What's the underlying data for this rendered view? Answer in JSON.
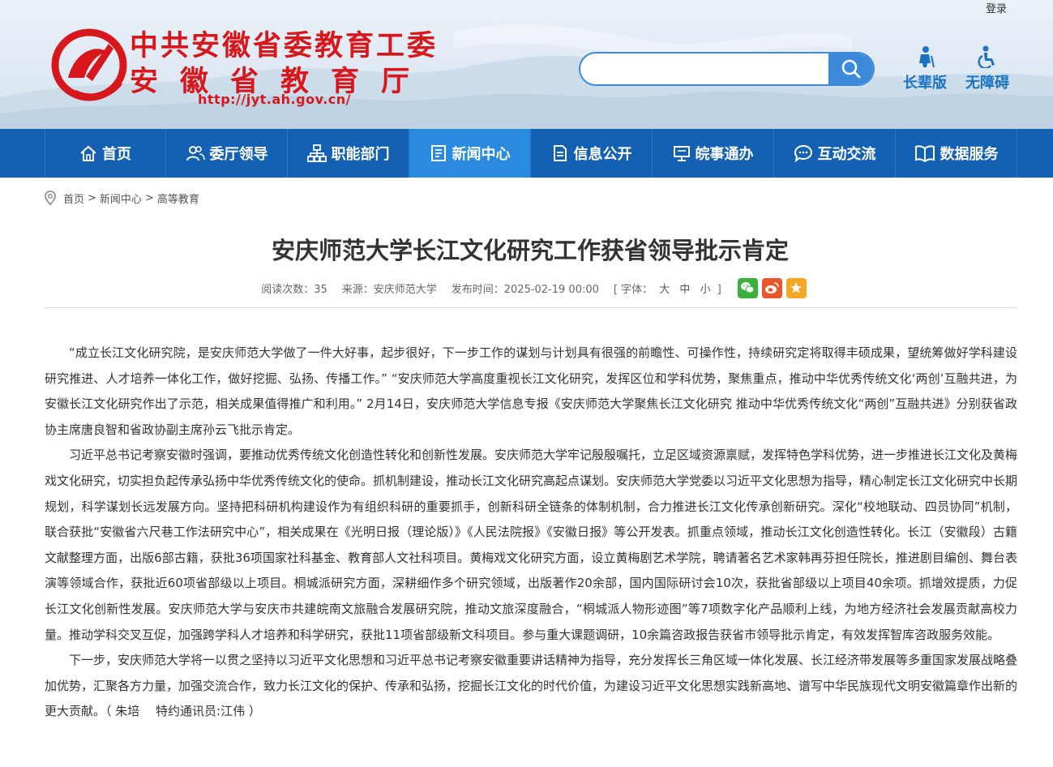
{
  "header": {
    "login": "登录",
    "logo_line1": "中共安徽省委教育工委",
    "logo_line2": "安徽省教育厅",
    "logo_url": "http://jyt.ah.gov.cn/",
    "search_placeholder": "",
    "tools": [
      {
        "label": "长辈版",
        "icon": "elder-icon"
      },
      {
        "label": "无障碍",
        "icon": "wheelchair-icon"
      }
    ]
  },
  "nav": [
    {
      "label": "首页",
      "icon": "home-icon"
    },
    {
      "label": "委厅领导",
      "icon": "people-icon"
    },
    {
      "label": "职能部门",
      "icon": "org-icon"
    },
    {
      "label": "新闻中心",
      "icon": "news-icon",
      "active": true
    },
    {
      "label": "信息公开",
      "icon": "document-icon"
    },
    {
      "label": "皖事通办",
      "icon": "monitor-icon"
    },
    {
      "label": "互动交流",
      "icon": "chat-icon"
    },
    {
      "label": "数据服务",
      "icon": "book-icon"
    }
  ],
  "breadcrumb": [
    "首页",
    "新闻中心",
    "高等教育"
  ],
  "article": {
    "title": "安庆师范大学长江文化研究工作获省领导批示肯定",
    "views": "阅读次数：35",
    "source": "来源：安庆师范大学",
    "time": "发布时间：2025-02-19 00:00",
    "font_label": "[ 字体：",
    "font_large": "大",
    "font_medium": "中",
    "font_small": "小",
    "font_end": "]",
    "share": [
      "wechat-icon",
      "weibo-icon",
      "favorite-icon"
    ],
    "paragraphs": [
      "“成立长江文化研究院，是安庆师范大学做了一件大好事，起步很好，下一步工作的谋划与计划具有很强的前瞻性、可操作性，持续研究定将取得丰硕成果，望统筹做好学科建设研究推进、人才培养一体化工作，做好挖掘、弘扬、传播工作。” “安庆师范大学高度重视长江文化研究，发挥区位和学科优势，聚焦重点，推动中华优秀传统文化‘两创’互融共进，为安徽长江文化研究作出了示范，相关成果值得推广和利用。” 2月14日，安庆师范大学信息专报《安庆师范大学聚焦长江文化研究 推动中华优秀传统文化“两创”互融共进》分别获省政协主席唐良智和省政协副主席孙云飞批示肯定。",
      "习近平总书记考察安徽时强调，要推动优秀传统文化创造性转化和创新性发展。安庆师范大学牢记殷殷嘱托，立足区域资源禀赋，发挥特色学科优势，进一步推进长江文化及黄梅戏文化研究，切实担负起传承弘扬中华优秀传统文化的使命。抓机制建设，推动长江文化研究高起点谋划。安庆师范大学党委以习近平文化思想为指导，精心制定长江文化研究中长期规划，科学谋划长远发展方向。坚持把科研机构建设作为有组织科研的重要抓手，创新科研全链条的体制机制，合力推进长江文化传承创新研究。深化“校地联动、四员协同”机制，联合获批“安徽省六尺巷工作法研究中心”，相关成果在《光明日报（理论版）》《人民法院报》《安徽日报》等公开发表。抓重点领域，推动长江文化创造性转化。长江（安徽段）古籍文献整理方面，出版6部古籍，获批36项国家社科基金、教育部人文社科项目。黄梅戏文化研究方面，设立黄梅剧艺术学院，聘请著名艺术家韩再芬担任院长，推进剧目编创、舞台表演等领域合作，获批近60项省部级以上项目。桐城派研究方面，深耕细作多个研究领域，出版著作20余部，国内国际研讨会10次，获批省部级以上项目40余项。抓增效提质，力促长江文化创新性发展。安庆师范大学与安庆市共建皖南文旅融合发展研究院，推动文旅深度融合，“桐城派人物形迹图”等7项数字化产品顺利上线，为地方经济社会发展贡献高校力量。推动学科交叉互促，加强跨学科人才培养和科学研究，获批11项省部级新文科项目。参与重大课题调研，10余篇咨政报告获省市领导批示肯定，有效发挥智库咨政服务效能。",
      "下一步，安庆师范大学将一以贯之坚持以习近平文化思想和习近平总书记考察安徽重要讲话精神为指导，充分发挥长三角区域一体化发展、长江经济带发展等多重国家发展战略叠加优势，汇聚各方力量，加强交流合作，致力长江文化的保护、传承和弘扬，挖掘长江文化的时代价值，为建设习近平文化思想实践新高地、谱写中华民族现代文明安徽篇章作出新的更大贡献。（ 朱培　 特约通讯员:江伟 ）"
    ]
  }
}
